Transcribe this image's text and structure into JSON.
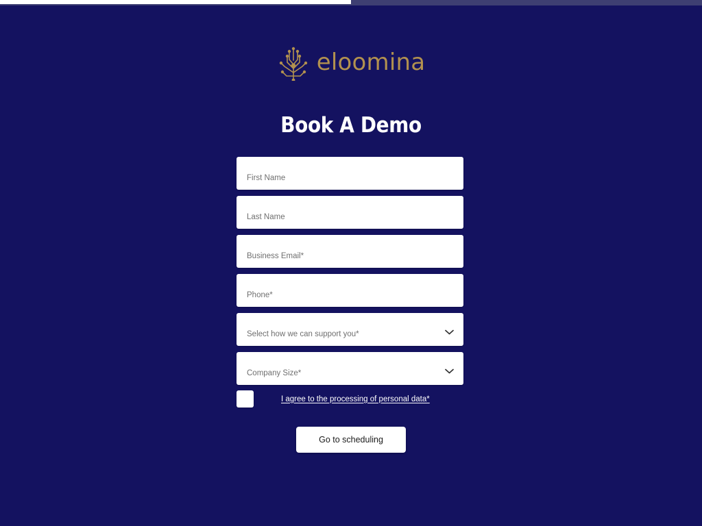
{
  "theme": {
    "background": "#141260",
    "accent_gold": "#b2914f",
    "field_background": "#ffffff",
    "progress_fill": "#ffffff",
    "progress_track": "#3e3f72"
  },
  "progress": {
    "percent": 50,
    "label": "50%"
  },
  "brand": {
    "mark_icon": "circuit-tree-icon",
    "wordmark": "eloomina"
  },
  "header": {
    "title": "Book A Demo"
  },
  "form": {
    "fields": [
      {
        "name": "first-name",
        "type": "text",
        "placeholder": "First Name",
        "value": ""
      },
      {
        "name": "last-name",
        "type": "text",
        "placeholder": "Last Name",
        "value": ""
      },
      {
        "name": "business-email",
        "type": "email",
        "placeholder": "Business Email*",
        "value": ""
      },
      {
        "name": "phone",
        "type": "tel",
        "placeholder": "Phone*",
        "value": ""
      },
      {
        "name": "support-type",
        "type": "select",
        "placeholder": "Select how we can support you*",
        "value": ""
      },
      {
        "name": "company-size",
        "type": "select",
        "placeholder": "Company Size*",
        "value": ""
      }
    ],
    "dropdown_icon": "chevron-down-icon",
    "consent": {
      "checked": false,
      "label": "I agree to the processing of personal data*"
    },
    "submit_label": "Go to scheduling"
  }
}
